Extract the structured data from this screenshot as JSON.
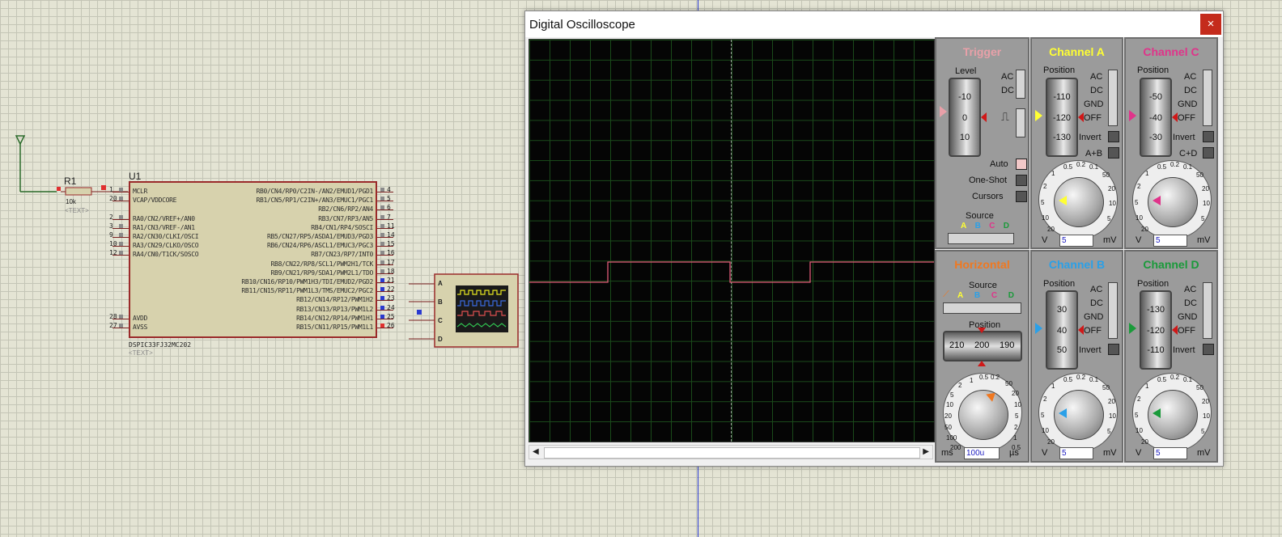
{
  "schematic": {
    "resistor": {
      "ref": "R1",
      "value": "10k",
      "text": "<TEXT>"
    },
    "chip": {
      "ref": "U1",
      "part": "DSPIC33FJ32MC202",
      "text": "<TEXT>",
      "left_pins": [
        {
          "num": "1",
          "label": "MCLR"
        },
        {
          "num": "20",
          "label": "VCAP/VDDCORE"
        },
        {
          "num": "2",
          "label": "RA0/CN2/VREF+/AN0"
        },
        {
          "num": "3",
          "label": "RA1/CN3/VREF-/AN1"
        },
        {
          "num": "9",
          "label": "RA2/CN30/CLKI/OSCI"
        },
        {
          "num": "10",
          "label": "RA3/CN29/CLKO/OSCO"
        },
        {
          "num": "12",
          "label": "RA4/CN0/T1CK/SOSCO"
        },
        {
          "num": "28",
          "label": "AVDD"
        },
        {
          "num": "27",
          "label": "AVSS"
        }
      ],
      "right_pins": [
        {
          "num": "4",
          "label": "RB0/CN4/RP0/C2IN-/AN2/EMUD1/PGD1"
        },
        {
          "num": "5",
          "label": "RB1/CN5/RP1/C2IN+/AN3/EMUC1/PGC1"
        },
        {
          "num": "6",
          "label": "RB2/CN6/RP2/AN4"
        },
        {
          "num": "7",
          "label": "RB3/CN7/RP3/AN5"
        },
        {
          "num": "11",
          "label": "RB4/CN1/RP4/SOSCI"
        },
        {
          "num": "14",
          "label": "RB5/CN27/RP5/ASDA1/EMUD3/PGD3"
        },
        {
          "num": "15",
          "label": "RB6/CN24/RP6/ASCL1/EMUC3/PGC3"
        },
        {
          "num": "16",
          "label": "RB7/CN23/RP7/INT0"
        },
        {
          "num": "17",
          "label": "RB8/CN22/RP8/SCL1/PWM2H1/TCK"
        },
        {
          "num": "18",
          "label": "RB9/CN21/RP9/SDA1/PWM2L1/TDO"
        },
        {
          "num": "21",
          "label": "RB10/CN16/RP10/PWM1H3/TDI/EMUD2/PGD2"
        },
        {
          "num": "22",
          "label": "RB11/CN15/RP11/PWM1L3/TMS/EMUC2/PGC2"
        },
        {
          "num": "23",
          "label": "RB12/CN14/RP12/PWM1H2"
        },
        {
          "num": "24",
          "label": "RB13/CN13/RP13/PWM1L2"
        },
        {
          "num": "25",
          "label": "RB14/CN12/RP14/PWM1H1"
        },
        {
          "num": "26",
          "label": "RB15/CN11/RP15/PWM1L1"
        }
      ]
    },
    "scope_symbol": {
      "inputs": [
        "A",
        "B",
        "C",
        "D"
      ]
    }
  },
  "window": {
    "title": "Digital Oscilloscope",
    "close": "×"
  },
  "scrollbar": {
    "left": "◀",
    "right": "▶"
  },
  "trace": {
    "color": "#e05a78",
    "points": [
      [
        0,
        300
      ],
      [
        97,
        300
      ],
      [
        97,
        275
      ],
      [
        248,
        275
      ],
      [
        248,
        300
      ],
      [
        347,
        300
      ],
      [
        347,
        275
      ],
      [
        500,
        275
      ]
    ]
  },
  "trigger": {
    "title": "Trigger",
    "level_label": "Level",
    "drum": [
      "-10",
      "0",
      "10"
    ],
    "ac": "AC",
    "dc": "DC",
    "auto": "Auto",
    "one_shot": "One-Shot",
    "cursors": "Cursors",
    "source_label": "Source",
    "sources": [
      "A",
      "B",
      "C",
      "D"
    ]
  },
  "channel_a": {
    "title": "Channel A",
    "position_label": "Position",
    "drum": [
      "-110",
      "-120",
      "-130"
    ],
    "modes": [
      "AC",
      "DC",
      "GND",
      "OFF"
    ],
    "invert": "Invert",
    "sum": "A+B",
    "ticks": [
      "0.5",
      "0.2",
      "0.1",
      "50",
      "20",
      "10",
      "5",
      "2",
      "1",
      "20",
      "10",
      "5",
      "2"
    ],
    "unit_left": "V",
    "value": "5",
    "unit_right": "mV",
    "color": "#ffff33"
  },
  "channel_c": {
    "title": "Channel C",
    "position_label": "Position",
    "drum": [
      "-50",
      "-40",
      "-30"
    ],
    "modes": [
      "AC",
      "DC",
      "GND",
      "OFF"
    ],
    "invert": "Invert",
    "sum": "C+D",
    "unit_left": "V",
    "value": "5",
    "unit_right": "mV",
    "color": "#e0338a"
  },
  "horizontal": {
    "title": "Horizontal",
    "source_label": "Source",
    "sources": [
      "A",
      "B",
      "C",
      "D"
    ],
    "position_label": "Position",
    "drum": [
      "210",
      "200",
      "190"
    ],
    "ticks": [
      "0.5",
      "0.2",
      "1",
      "50",
      "2",
      "20",
      "5",
      "10",
      "10",
      "5",
      "20",
      "2",
      "50",
      "1",
      "100",
      "0.5",
      "200"
    ],
    "unit_left": "ms",
    "value": "100u",
    "unit_right": "µs",
    "color": "#f07820"
  },
  "channel_b": {
    "title": "Channel B",
    "position_label": "Position",
    "drum": [
      "30",
      "40",
      "50"
    ],
    "modes": [
      "AC",
      "DC",
      "GND",
      "OFF"
    ],
    "invert": "Invert",
    "unit_left": "V",
    "value": "5",
    "unit_right": "mV",
    "color": "#2aa0e8"
  },
  "channel_d": {
    "title": "Channel D",
    "position_label": "Position",
    "drum": [
      "-130",
      "-120",
      "-110"
    ],
    "modes": [
      "AC",
      "DC",
      "GND",
      "OFF"
    ],
    "invert": "Invert",
    "unit_left": "V",
    "value": "5",
    "unit_right": "mV",
    "color": "#1a9a3a"
  }
}
